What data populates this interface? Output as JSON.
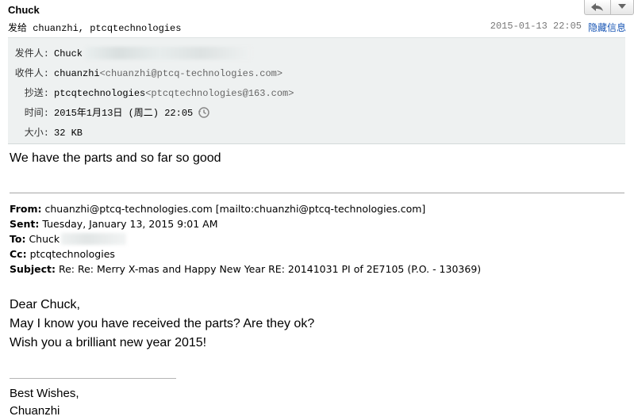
{
  "header": {
    "sender": "Chuck",
    "to_line": "发给 chuanzhi, ptcqtechnologies",
    "date": "2015-01-13 22:05",
    "hide_link": "隐藏信息"
  },
  "toolbar": {
    "reply_icon": "reply-icon",
    "more_icon": "chevron-down-icon"
  },
  "details": {
    "from_label": "发件人:",
    "from_value": "Chuck",
    "to_label": "收件人:",
    "to_name": "chuanzhi",
    "to_addr": "<chuanzhi@ptcq-technologies.com>",
    "cc_label": "抄送:",
    "cc_name": "ptcqtechnologies",
    "cc_addr": "<ptcqtechnologies@163.com>",
    "time_label": "时间:",
    "time_value": "2015年1月13日 (周二) 22:05",
    "size_label": "大小:",
    "size_value": "32 KB"
  },
  "body": {
    "first_line": "We have the parts and so far so good",
    "quoted": {
      "from_label": "From:",
      "from_value": "chuanzhi@ptcq-technologies.com [mailto:chuanzhi@ptcq-technologies.com]",
      "sent_label": "Sent:",
      "sent_value": "Tuesday, January 13, 2015 9:01 AM",
      "to_label": "To:",
      "to_value": "Chuck",
      "cc_label": "Cc:",
      "cc_value": "ptcqtechnologies",
      "subject_label": "Subject:",
      "subject_value": "Re: Re: Merry X-mas and Happy New Year RE: 20141031 PI of 2E7105 (P.O. - 130369)"
    },
    "greeting": "Dear Chuck,",
    "line1": "May I know you have received the parts? Are they ok?",
    "line2": "Wish you a brilliant new year 2015!",
    "signoff": "Best Wishes,",
    "signature": "Chuanzhi"
  }
}
